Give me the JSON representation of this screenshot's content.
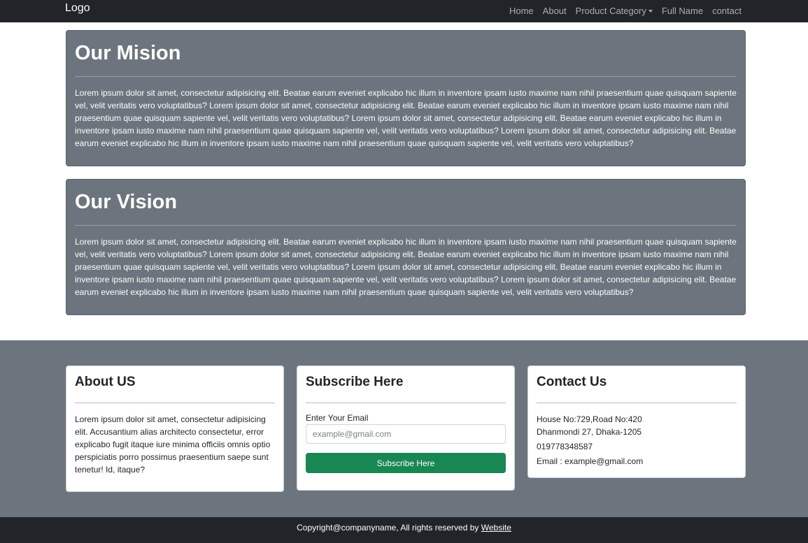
{
  "navbar": {
    "brand": "Logo",
    "links": [
      {
        "label": "Home"
      },
      {
        "label": "About"
      },
      {
        "label": "Product Category"
      },
      {
        "label": "Full Name"
      },
      {
        "label": "contact"
      }
    ]
  },
  "mission": {
    "title": "Our Mision",
    "body": "Lorem ipsum dolor sit amet, consectetur adipisicing elit. Beatae earum eveniet explicabo hic illum in inventore ipsam iusto maxime nam nihil praesentium quae quisquam sapiente vel, velit veritatis vero voluptatibus? Lorem ipsum dolor sit amet, consectetur adipisicing elit. Beatae earum eveniet explicabo hic illum in inventore ipsam iusto maxime nam nihil praesentium quae quisquam sapiente vel, velit veritatis vero voluptatibus? Lorem ipsum dolor sit amet, consectetur adipisicing elit. Beatae earum eveniet explicabo hic illum in inventore ipsam iusto maxime nam nihil praesentium quae quisquam sapiente vel, velit veritatis vero voluptatibus? Lorem ipsum dolor sit amet, consectetur adipisicing elit. Beatae earum eveniet explicabo hic illum in inventore ipsam iusto maxime nam nihil praesentium quae quisquam sapiente vel, velit veritatis vero voluptatibus?"
  },
  "vision": {
    "title": "Our Vision",
    "body": "Lorem ipsum dolor sit amet, consectetur adipisicing elit. Beatae earum eveniet explicabo hic illum in inventore ipsam iusto maxime nam nihil praesentium quae quisquam sapiente vel, velit veritatis vero voluptatibus? Lorem ipsum dolor sit amet, consectetur adipisicing elit. Beatae earum eveniet explicabo hic illum in inventore ipsam iusto maxime nam nihil praesentium quae quisquam sapiente vel, velit veritatis vero voluptatibus? Lorem ipsum dolor sit amet, consectetur adipisicing elit. Beatae earum eveniet explicabo hic illum in inventore ipsam iusto maxime nam nihil praesentium quae quisquam sapiente vel, velit veritatis vero voluptatibus? Lorem ipsum dolor sit amet, consectetur adipisicing elit. Beatae earum eveniet explicabo hic illum in inventore ipsam iusto maxime nam nihil praesentium quae quisquam sapiente vel, velit veritatis vero voluptatibus?"
  },
  "footer": {
    "about": {
      "title": "About US",
      "body": "Lorem ipsum dolor sit amet, consectetur adipisicing elit. Accusantium alias architecto consectetur, error explicabo fugit itaque iure minima officiis omnis optio perspiciatis porro possimus praesentium saepe sunt tenetur! Id, itaque?"
    },
    "subscribe": {
      "title": "Subscribe Here",
      "email_label": "Enter Your Email",
      "email_placeholder": "example@gmail.com",
      "email_value": "",
      "button_label": "Subscribe Here"
    },
    "contact": {
      "title": "Contact Us",
      "address_line1": "House No:729,Road No:420",
      "address_line2": "Dhanmondi 27, Dhaka-1205",
      "phone": "019778348587",
      "email": "Email : example@gmail.com"
    },
    "copyright_text": "Copyright@companyname, All rights reserved by ",
    "copyright_link": "Website"
  },
  "colors": {
    "navbar_bg": "#212529",
    "card_gray": "#6c757d",
    "button_green": "#198754"
  }
}
